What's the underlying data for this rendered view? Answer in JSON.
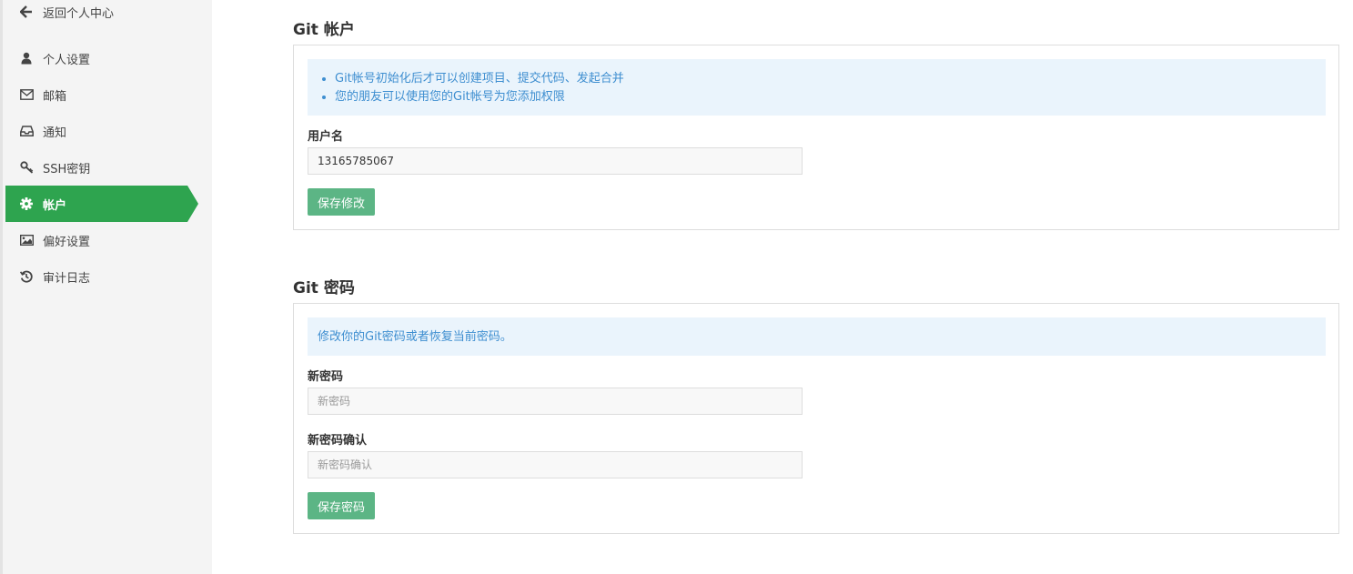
{
  "sidebar": {
    "back": {
      "label": "返回个人中心",
      "icon": "arrow-left-icon"
    },
    "items": [
      {
        "label": "个人设置",
        "icon": "user-icon",
        "active": false
      },
      {
        "label": "邮箱",
        "icon": "envelope-icon",
        "active": false
      },
      {
        "label": "通知",
        "icon": "inbox-icon",
        "active": false
      },
      {
        "label": "SSH密钥",
        "icon": "key-icon",
        "active": false
      },
      {
        "label": "帐户",
        "icon": "gear-icon",
        "active": true
      },
      {
        "label": "偏好设置",
        "icon": "image-icon",
        "active": false
      },
      {
        "label": "审计日志",
        "icon": "history-icon",
        "active": false
      }
    ]
  },
  "account": {
    "title": "Git 帐户",
    "notes": [
      "Git帐号初始化后才可以创建项目、提交代码、发起合并",
      "您的朋友可以使用您的Git帐号为您添加权限"
    ],
    "username_label": "用户名",
    "username_value": "13165785067",
    "save_label": "保存修改"
  },
  "password": {
    "title": "Git 密码",
    "note": "修改你的Git密码或者恢复当前密码。",
    "new_label": "新密码",
    "new_placeholder": "新密码",
    "confirm_label": "新密码确认",
    "confirm_placeholder": "新密码确认",
    "save_label": "保存密码"
  },
  "colors": {
    "accent": "#2ea44f",
    "button": "#5cb585",
    "info_bg": "#eaf4fc",
    "info_text": "#3e8ed0"
  }
}
